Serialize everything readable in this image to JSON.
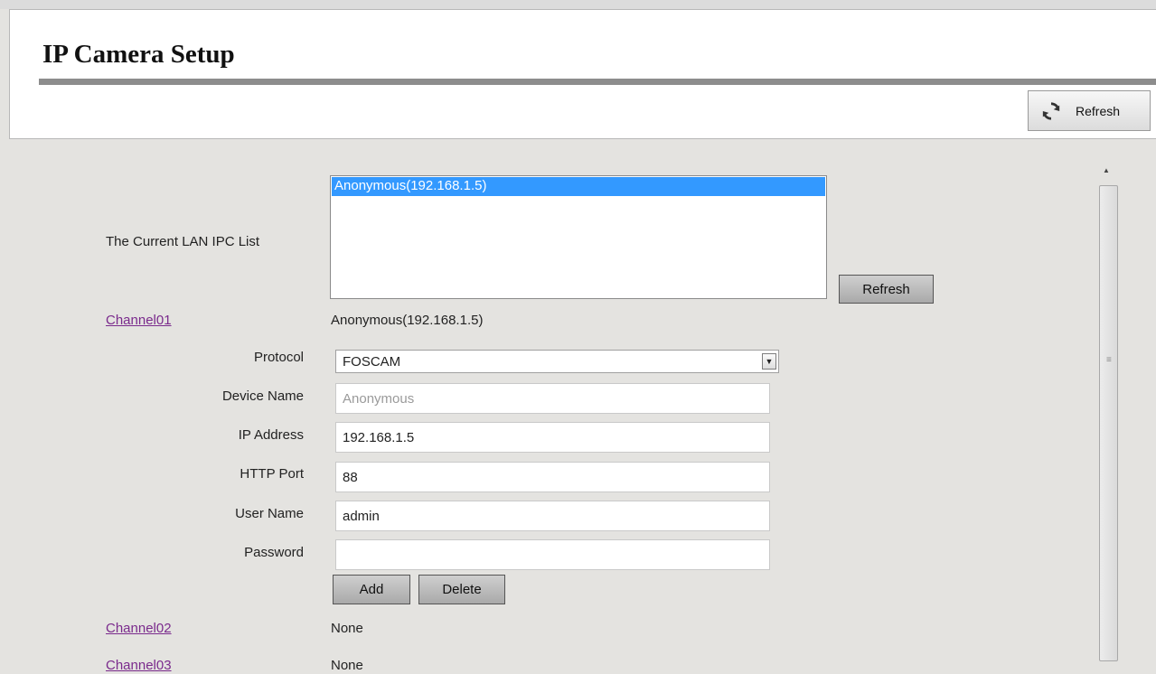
{
  "header": {
    "title": "IP Camera Setup",
    "refresh_label": "Refresh",
    "refresh_icon": "refresh-icon"
  },
  "lan_list": {
    "label": "The Current LAN IPC List",
    "items": [
      "Anonymous(192.168.1.5)"
    ],
    "selected_index": 0,
    "refresh_label": "Refresh"
  },
  "channels": [
    {
      "label": "Channel01",
      "value": "Anonymous(192.168.1.5)"
    },
    {
      "label": "Channel02",
      "value": "None"
    },
    {
      "label": "Channel03",
      "value": "None"
    }
  ],
  "form": {
    "protocol_label": "Protocol",
    "protocol_value": "FOSCAM",
    "device_name_label": "Device Name",
    "device_name_value": "Anonymous",
    "ip_label": "IP Address",
    "ip_value": "192.168.1.5",
    "port_label": "HTTP Port",
    "port_value": "88",
    "user_label": "User Name",
    "user_value": "admin",
    "password_label": "Password",
    "password_value": "",
    "add_label": "Add",
    "delete_label": "Delete"
  },
  "colors": {
    "selection": "#3399ff",
    "link": "#7a2a8c",
    "background": "#e4e3e0"
  }
}
